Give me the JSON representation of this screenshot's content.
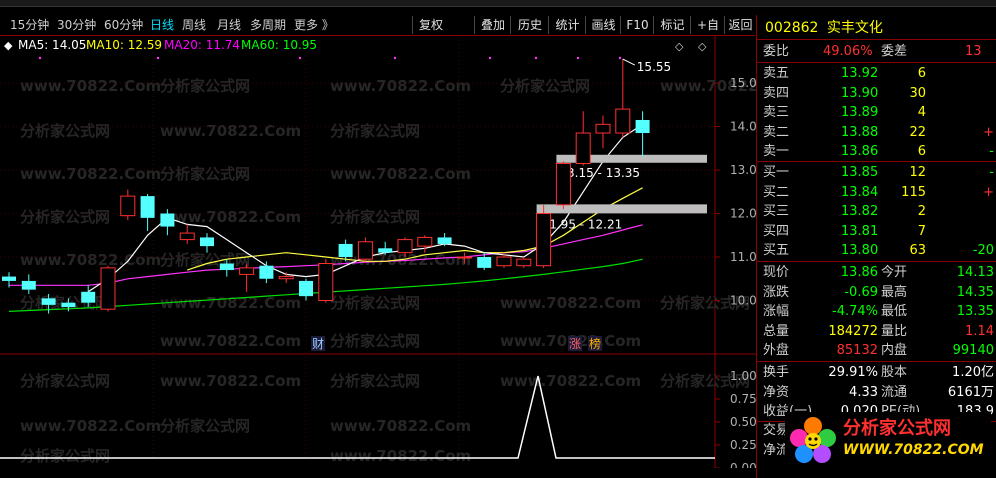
{
  "toolbar": {
    "periods": [
      "15分钟",
      "30分钟",
      "60分钟",
      "日线",
      "周线",
      "月线",
      "多周期",
      "更多 》"
    ],
    "active_period": "日线",
    "buttons": [
      "复权",
      "叠加",
      "历史",
      "统计",
      "画线",
      "F10",
      "标记",
      "+自选",
      "返回"
    ]
  },
  "ma_legend": [
    {
      "label": "MA5: 14.05",
      "color": "#ffffff"
    },
    {
      "label": "MA10: 12.59",
      "color": "#ffff00"
    },
    {
      "label": "MA20: 11.74",
      "color": "#ff00ff"
    },
    {
      "label": "MA60: 10.95",
      "color": "#00ff00"
    }
  ],
  "watermark": {
    "site": "www.70822.Com",
    "name": "分析家公式网"
  },
  "chart_data": {
    "type": "candlestick",
    "price_axis": [
      "15.00",
      "14.00",
      "13.00",
      "12.00",
      "11.00",
      "10.00"
    ],
    "volume_axis": [
      "1.00",
      "0.75",
      "0.50",
      "0.25",
      "0.00"
    ],
    "ylim": [
      9.5,
      15.8
    ],
    "annotations": {
      "high_label": "15.55",
      "gap1": "13.15 - 13.35",
      "gap2": "11.95 - 12.21",
      "markers": [
        "财",
        "涨",
        "榜"
      ]
    },
    "candles": [
      {
        "o": 10.55,
        "c": 10.45,
        "h": 10.65,
        "l": 10.3
      },
      {
        "o": 10.45,
        "c": 10.25,
        "h": 10.6,
        "l": 10.15
      },
      {
        "o": 10.05,
        "c": 9.9,
        "h": 10.15,
        "l": 9.7
      },
      {
        "o": 9.95,
        "c": 9.85,
        "h": 10.05,
        "l": 9.75
      },
      {
        "o": 10.2,
        "c": 9.95,
        "h": 10.35,
        "l": 9.85
      },
      {
        "o": 9.8,
        "c": 10.75,
        "h": 10.8,
        "l": 9.75
      },
      {
        "o": 11.95,
        "c": 12.4,
        "h": 12.55,
        "l": 11.85
      },
      {
        "o": 12.4,
        "c": 11.9,
        "h": 12.45,
        "l": 11.6
      },
      {
        "o": 12.0,
        "c": 11.7,
        "h": 12.1,
        "l": 11.5
      },
      {
        "o": 11.4,
        "c": 11.55,
        "h": 11.75,
        "l": 11.3
      },
      {
        "o": 11.45,
        "c": 11.25,
        "h": 11.55,
        "l": 11.1
      },
      {
        "o": 10.85,
        "c": 10.7,
        "h": 10.95,
        "l": 10.55
      },
      {
        "o": 10.6,
        "c": 10.75,
        "h": 10.85,
        "l": 10.2
      },
      {
        "o": 10.8,
        "c": 10.5,
        "h": 10.9,
        "l": 10.4
      },
      {
        "o": 10.5,
        "c": 10.55,
        "h": 10.65,
        "l": 10.4
      },
      {
        "o": 10.45,
        "c": 10.1,
        "h": 10.5,
        "l": 10.0
      },
      {
        "o": 10.0,
        "c": 10.85,
        "h": 10.95,
        "l": 9.95
      },
      {
        "o": 11.3,
        "c": 11.0,
        "h": 11.4,
        "l": 10.9
      },
      {
        "o": 10.95,
        "c": 11.35,
        "h": 11.45,
        "l": 10.9
      },
      {
        "o": 11.2,
        "c": 11.1,
        "h": 11.35,
        "l": 11.05
      },
      {
        "o": 11.1,
        "c": 11.4,
        "h": 11.45,
        "l": 11.0
      },
      {
        "o": 11.25,
        "c": 11.45,
        "h": 11.5,
        "l": 11.1
      },
      {
        "o": 11.45,
        "c": 11.3,
        "h": 11.55,
        "l": 11.25
      },
      {
        "o": 11.0,
        "c": 11.0,
        "h": 11.1,
        "l": 10.85
      },
      {
        "o": 11.0,
        "c": 10.75,
        "h": 11.1,
        "l": 10.7
      },
      {
        "o": 10.8,
        "c": 11.0,
        "h": 11.1,
        "l": 10.75
      },
      {
        "o": 10.8,
        "c": 10.95,
        "h": 11.0,
        "l": 10.75
      },
      {
        "o": 10.8,
        "c": 12.0,
        "h": 12.2,
        "l": 10.75
      },
      {
        "o": 12.2,
        "c": 13.15,
        "h": 13.2,
        "l": 12.1
      },
      {
        "o": 13.15,
        "c": 13.85,
        "h": 14.35,
        "l": 13.1
      },
      {
        "o": 13.85,
        "c": 14.05,
        "h": 14.25,
        "l": 13.5
      },
      {
        "o": 13.85,
        "c": 14.4,
        "h": 15.55,
        "l": 13.75
      },
      {
        "o": 14.15,
        "c": 13.85,
        "h": 14.35,
        "l": 13.3
      }
    ],
    "ma5": [
      null,
      null,
      null,
      null,
      10.2,
      10.5,
      10.9,
      11.5,
      11.9,
      11.75,
      11.7,
      11.4,
      11.1,
      10.8,
      10.6,
      10.55,
      10.6,
      10.8,
      11.0,
      11.1,
      11.15,
      11.2,
      11.3,
      11.25,
      11.1,
      11.05,
      11.0,
      11.3,
      11.8,
      12.5,
      13.2,
      13.75,
      14.05
    ],
    "ma10": [
      null,
      null,
      null,
      null,
      null,
      null,
      null,
      null,
      null,
      10.7,
      10.85,
      10.95,
      11.0,
      11.05,
      11.1,
      11.05,
      11.0,
      10.95,
      10.9,
      10.9,
      10.95,
      11.05,
      11.1,
      11.15,
      11.1,
      11.1,
      11.15,
      11.25,
      11.5,
      11.8,
      12.1,
      12.35,
      12.59
    ],
    "ma20": [
      10.35,
      10.35,
      10.35,
      10.35,
      10.35,
      10.4,
      10.5,
      10.55,
      10.6,
      10.65,
      10.7,
      10.72,
      10.74,
      10.76,
      10.78,
      10.8,
      10.82,
      10.85,
      10.88,
      10.9,
      10.92,
      10.95,
      10.98,
      11.0,
      11.05,
      11.1,
      11.12,
      11.2,
      11.3,
      11.4,
      11.5,
      11.62,
      11.74
    ],
    "ma60": [
      9.75,
      9.77,
      9.79,
      9.81,
      9.83,
      9.86,
      9.89,
      9.92,
      9.95,
      9.98,
      10.01,
      10.04,
      10.07,
      10.1,
      10.13,
      10.16,
      10.19,
      10.22,
      10.25,
      10.28,
      10.31,
      10.34,
      10.37,
      10.41,
      10.45,
      10.5,
      10.55,
      10.6,
      10.66,
      10.72,
      10.78,
      10.85,
      10.95
    ]
  },
  "quote": {
    "code": "002862",
    "name": "实丰文化",
    "weibi_label": "委比",
    "weibi": "49.06%",
    "weicha_label": "委差",
    "weicha": "13",
    "sell": [
      {
        "label": "卖五",
        "price": "13.92",
        "vol": "6",
        "chg": ""
      },
      {
        "label": "卖四",
        "price": "13.90",
        "vol": "30",
        "chg": ""
      },
      {
        "label": "卖三",
        "price": "13.89",
        "vol": "4",
        "chg": ""
      },
      {
        "label": "卖二",
        "price": "13.88",
        "vol": "22",
        "chg": "+"
      },
      {
        "label": "卖一",
        "price": "13.86",
        "vol": "6",
        "chg": "-"
      }
    ],
    "buy": [
      {
        "label": "买一",
        "price": "13.85",
        "vol": "12",
        "chg": "-"
      },
      {
        "label": "买二",
        "price": "13.84",
        "vol": "115",
        "chg": "+"
      },
      {
        "label": "买三",
        "price": "13.82",
        "vol": "2",
        "chg": ""
      },
      {
        "label": "买四",
        "price": "13.81",
        "vol": "7",
        "chg": ""
      },
      {
        "label": "买五",
        "price": "13.80",
        "vol": "63",
        "chg": "-20"
      }
    ],
    "stats": [
      {
        "l1": "现价",
        "v1": "13.86",
        "c1": "#00ff00",
        "l2": "今开",
        "v2": "14.13",
        "c2": "#00ff00"
      },
      {
        "l1": "涨跌",
        "v1": "-0.69",
        "c1": "#00ff00",
        "l2": "最高",
        "v2": "14.35",
        "c2": "#00ff00"
      },
      {
        "l1": "涨幅",
        "v1": "-4.74%",
        "c1": "#00ff00",
        "l2": "最低",
        "v2": "13.35",
        "c2": "#00ff00"
      },
      {
        "l1": "总量",
        "v1": "184272",
        "c1": "#ffff00",
        "l2": "量比",
        "v2": "1.14",
        "c2": "#ff3030"
      },
      {
        "l1": "外盘",
        "v1": "85132",
        "c1": "#ff3030",
        "l2": "内盘",
        "v2": "99140",
        "c2": "#00ff00"
      }
    ],
    "fund": [
      {
        "l1": "换手",
        "v1": "29.91%",
        "l2": "股本",
        "v2": "1.20亿"
      },
      {
        "l1": "净资",
        "v1": "4.33",
        "l2": "流通",
        "v2": "6161万"
      },
      {
        "l1": "收益(一)",
        "v1": "0.020",
        "l2": "PE(动)",
        "v2": "183.9"
      }
    ],
    "extra": [
      "交易",
      "净流"
    ]
  },
  "logo": {
    "text": "分析家公式网",
    "url": "WWW.70822.COM"
  }
}
